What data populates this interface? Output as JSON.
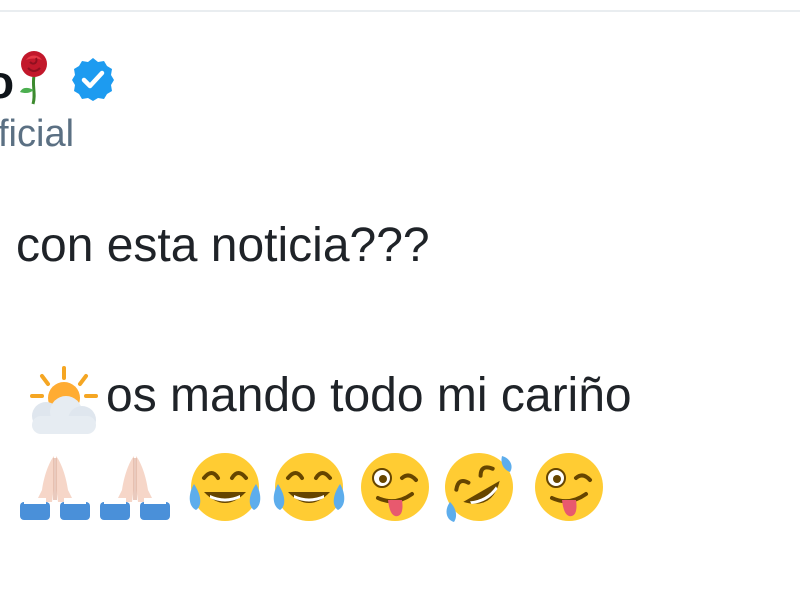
{
  "tweet": {
    "name_fragment": "o",
    "handle": "ficial",
    "line1": "con esta noticia???",
    "line2_text": "os mando todo mi cariño",
    "icons": {
      "name_emoji": "rose-icon",
      "badge": "verified-badge-icon",
      "line2_emoji": "sun-behind-cloud-icon",
      "line3_emojis": [
        "folded-hands-icon",
        "folded-hands-icon",
        "tears-of-joy-icon",
        "tears-of-joy-icon",
        "winking-tongue-icon",
        "rolling-laughing-icon",
        "winking-tongue-icon"
      ]
    },
    "colors": {
      "text": "#1f2328",
      "secondary": "#5b7083",
      "verified": "#1d9bf0",
      "emoji_yellow": "#ffcc33"
    }
  }
}
